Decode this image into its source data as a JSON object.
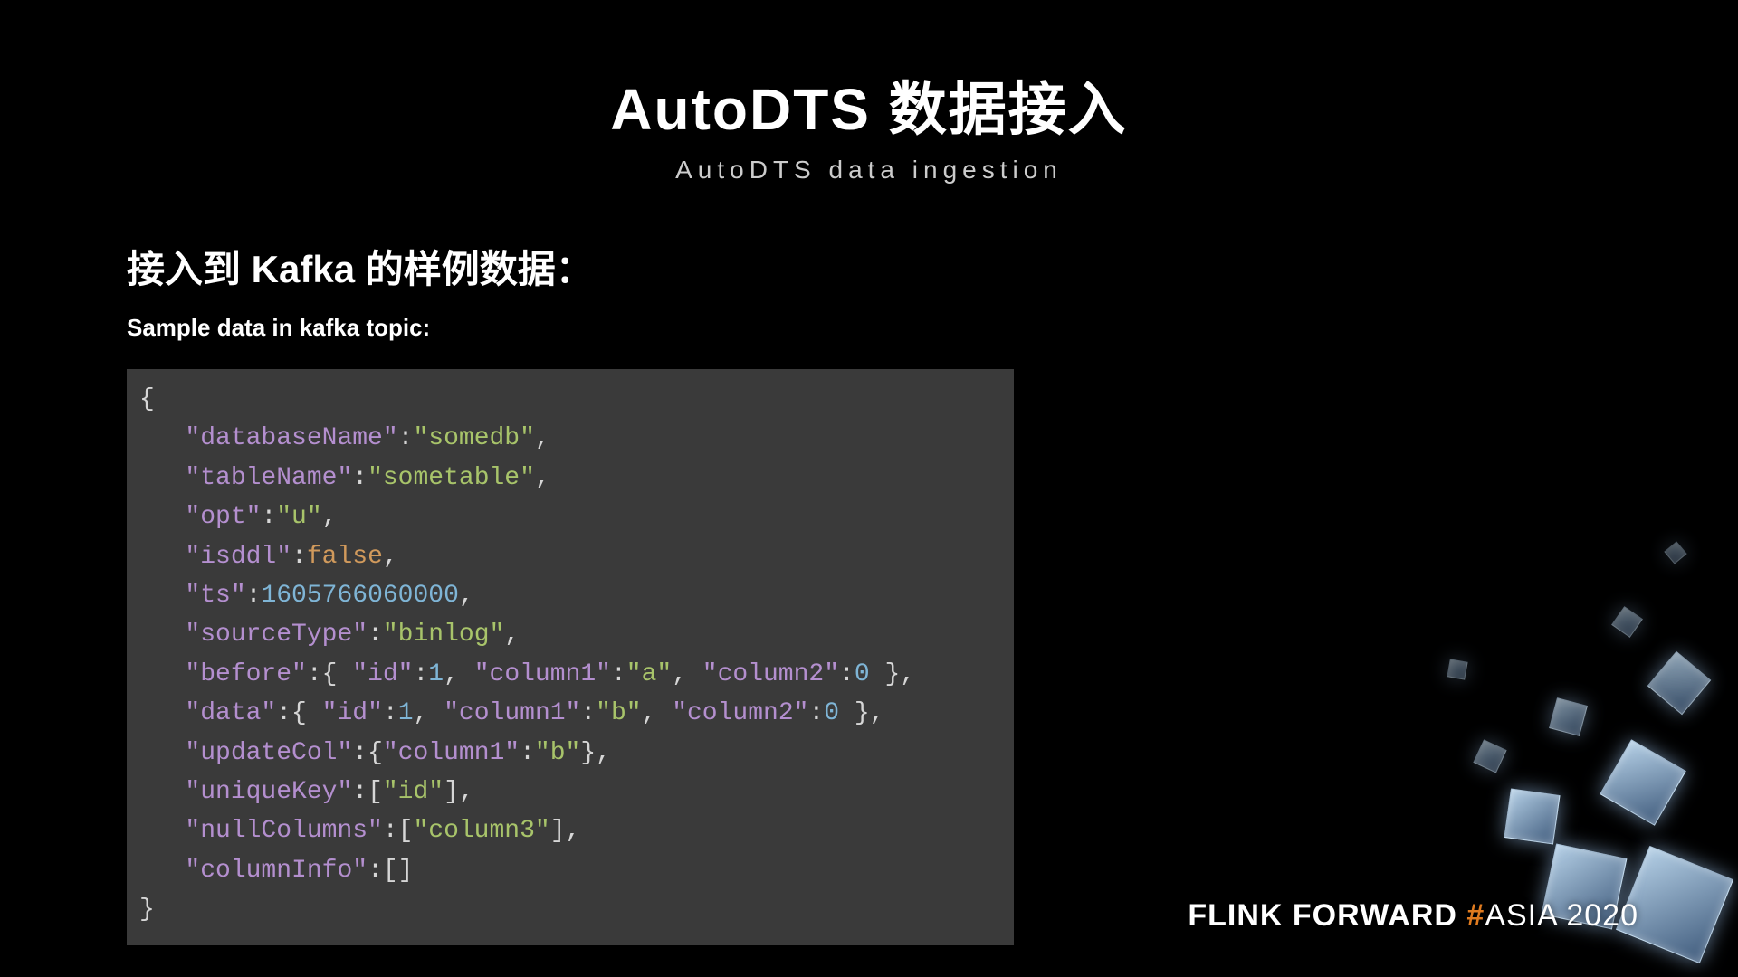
{
  "title": {
    "main": "AutoDTS 数据接入",
    "sub": "AutoDTS data ingestion"
  },
  "section": {
    "cn": "接入到 Kafka 的样例数据：",
    "en": "Sample data in kafka topic:"
  },
  "code": {
    "open": "{",
    "close": "}",
    "keys": {
      "databaseName": "\"databaseName\"",
      "tableName": "\"tableName\"",
      "opt": "\"opt\"",
      "isddl": "\"isddl\"",
      "ts": "\"ts\"",
      "sourceType": "\"sourceType\"",
      "before": "\"before\"",
      "data": "\"data\"",
      "updateCol": "\"updateCol\"",
      "uniqueKey": "\"uniqueKey\"",
      "nullColumns": "\"nullColumns\"",
      "columnInfo": "\"columnInfo\"",
      "id": "\"id\"",
      "column1": "\"column1\"",
      "column2": "\"column2\""
    },
    "vals": {
      "somedb": "\"somedb\"",
      "sometable": "\"sometable\"",
      "u": "\"u\"",
      "false": "false",
      "ts": "1605766060000",
      "binlog": "\"binlog\"",
      "one": "1",
      "zero": "0",
      "a": "\"a\"",
      "b": "\"b\"",
      "idStr": "\"id\"",
      "column3": "\"column3\""
    }
  },
  "footer": {
    "brand": "FLINK FORWARD ",
    "hash": "#",
    "rest": "ASIA 2020"
  }
}
